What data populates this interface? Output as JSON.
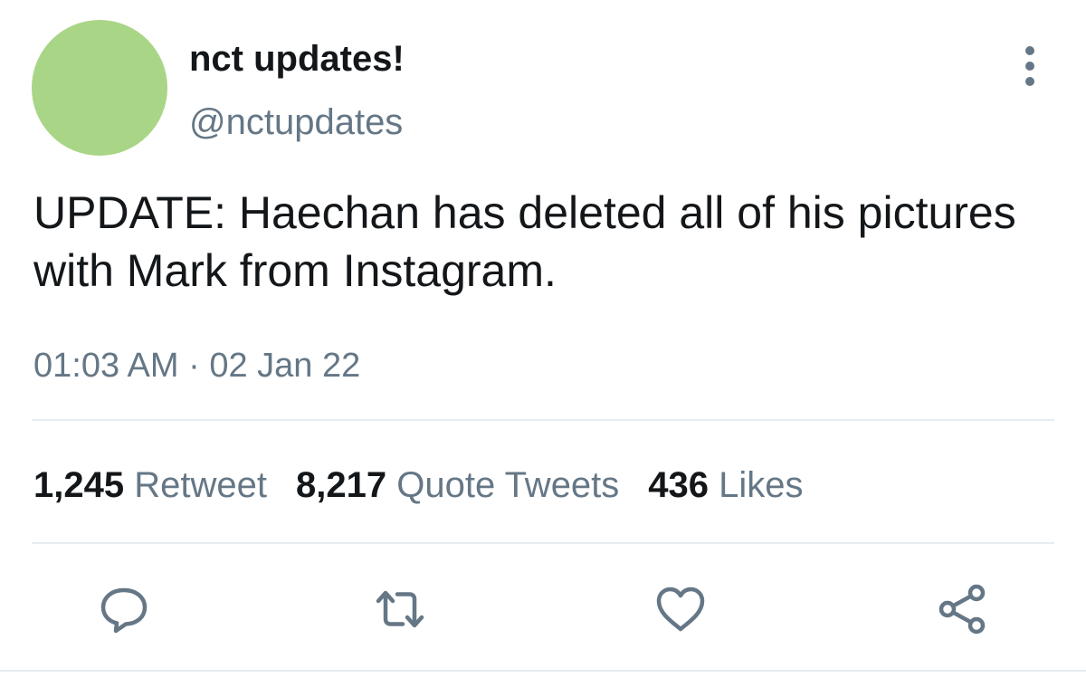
{
  "author": {
    "display_name": "nct updates!",
    "handle": "@nctupdates",
    "avatar_color": "#a9d586"
  },
  "tweet": {
    "text": "UPDATE: Haechan has deleted all of his pictures with Mark from Instagram.",
    "timestamp": "01:03 AM · 02 Jan 22"
  },
  "stats": {
    "retweets": {
      "count": "1,245",
      "label": "Retweet"
    },
    "quotes": {
      "count": "8,217",
      "label": "Quote Tweets"
    },
    "likes": {
      "count": "436",
      "label": "Likes"
    }
  },
  "actions": {
    "reply_icon": "speech-bubble-icon",
    "retweet_icon": "retweet-arrows-icon",
    "like_icon": "heart-icon",
    "share_icon": "share-nodes-icon",
    "more_icon": "vertical-ellipsis-icon"
  },
  "colors": {
    "text_primary": "#14171a",
    "text_secondary": "#657786",
    "divider": "#e6ecf0",
    "icon": "#657786"
  }
}
